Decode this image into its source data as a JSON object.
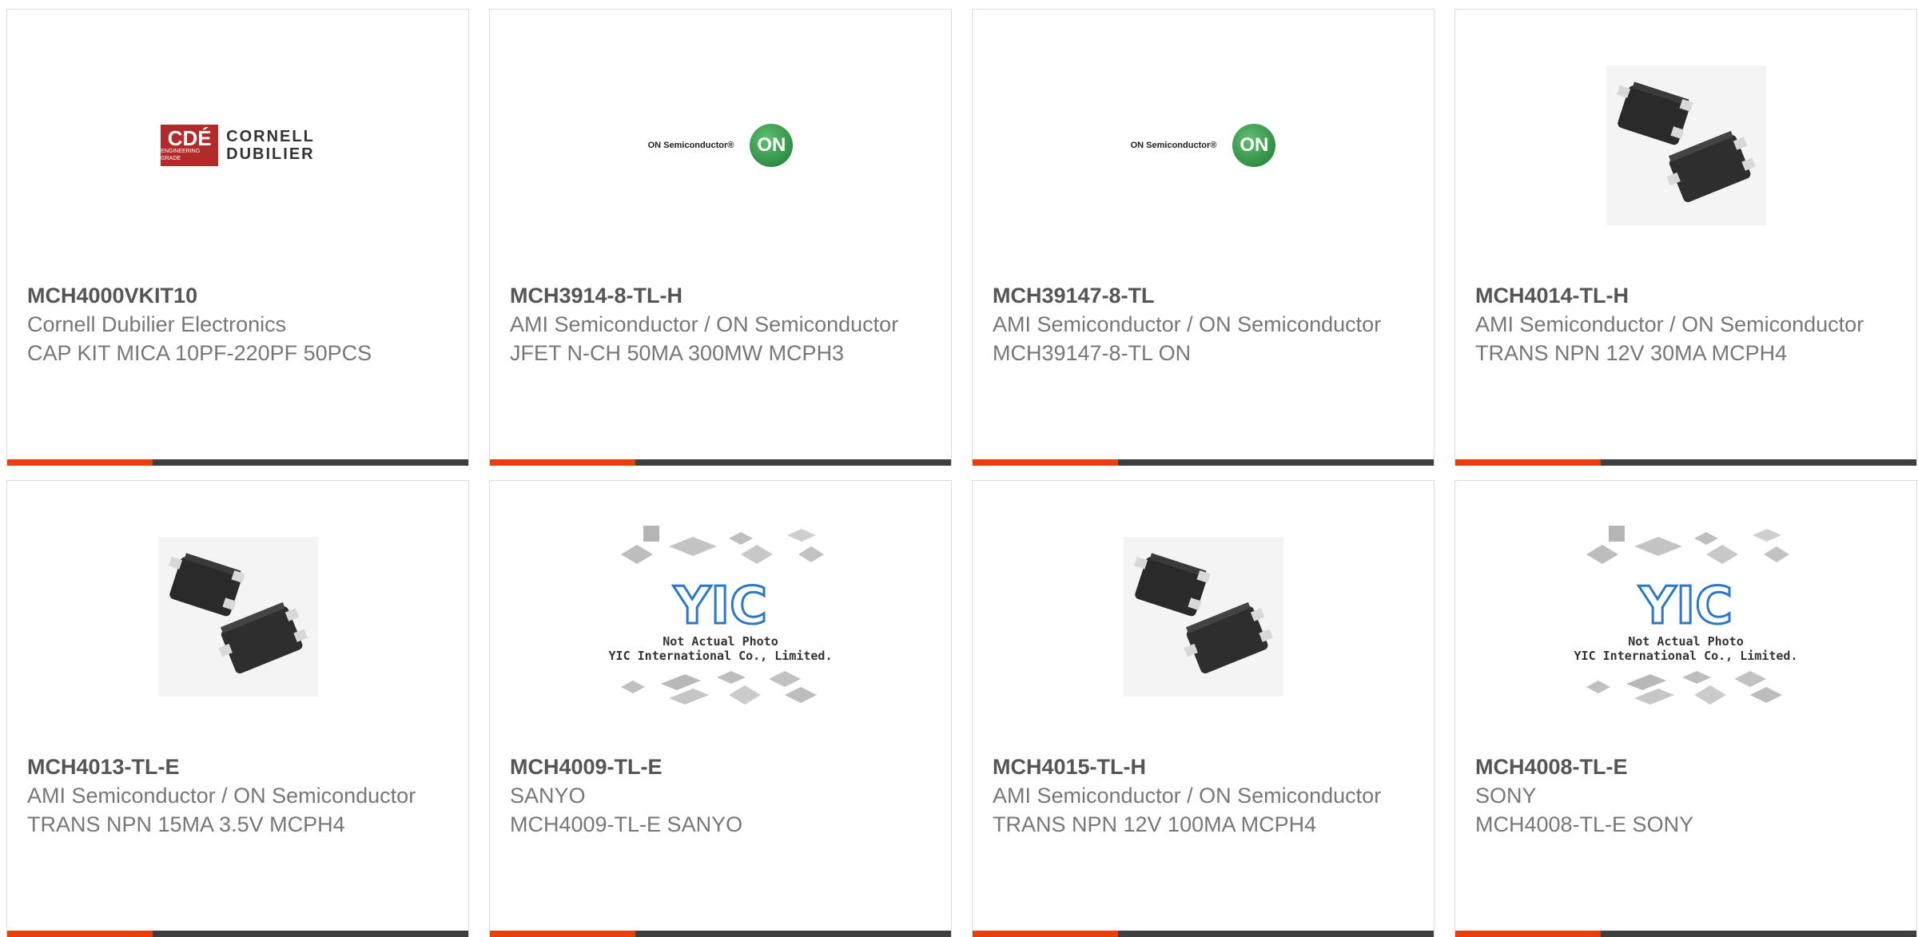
{
  "products": [
    {
      "part": "MCH4000VKIT10",
      "mfr": "Cornell Dubilier Electronics",
      "desc": "CAP KIT MICA 10PF-220PF 50PCS",
      "image": "cornell-dubilier-logo"
    },
    {
      "part": "MCH3914-8-TL-H",
      "mfr": "AMI Semiconductor / ON Semiconductor",
      "desc": "JFET N-CH 50MA 300MW MCPH3",
      "image": "on-semiconductor-logo"
    },
    {
      "part": "MCH39147-8-TL",
      "mfr": "AMI Semiconductor / ON Semiconductor",
      "desc": "MCH39147-8-TL ON",
      "image": "on-semiconductor-logo"
    },
    {
      "part": "MCH4014-TL-H",
      "mfr": "AMI Semiconductor / ON Semiconductor",
      "desc": "TRANS NPN 12V 30MA MCPH4",
      "image": "smd-transistor-photo"
    },
    {
      "part": "MCH4013-TL-E",
      "mfr": "AMI Semiconductor / ON Semiconductor",
      "desc": "TRANS NPN 15MA 3.5V MCPH4",
      "image": "smd-transistor-photo"
    },
    {
      "part": "MCH4009-TL-E",
      "mfr": "SANYO",
      "desc": "MCH4009-TL-E SANYO",
      "image": "yic-placeholder"
    },
    {
      "part": "MCH4015-TL-H",
      "mfr": "AMI Semiconductor / ON Semiconductor",
      "desc": "TRANS NPN 12V 100MA MCPH4",
      "image": "smd-transistor-photo"
    },
    {
      "part": "MCH4008-TL-E",
      "mfr": "SONY",
      "desc": "MCH4008-TL-E SONY",
      "image": "yic-placeholder"
    }
  ],
  "logos": {
    "cde_mark": "CDÉ",
    "cde_name_line1": "CORNELL",
    "cde_name_line2": "DUBILIER",
    "cde_tagline": "ENGINEERING GRADE",
    "on_text": "ON Semiconductor®",
    "on_badge": "ON",
    "yic_mark": "YIC",
    "yic_caption_line1": "Not Actual Photo",
    "yic_caption_line2": "YIC International Co., Limited."
  },
  "colors": {
    "accent": "#e8400c",
    "bar": "#3f3f3f",
    "title_text": "#555555",
    "body_text": "#777777"
  }
}
